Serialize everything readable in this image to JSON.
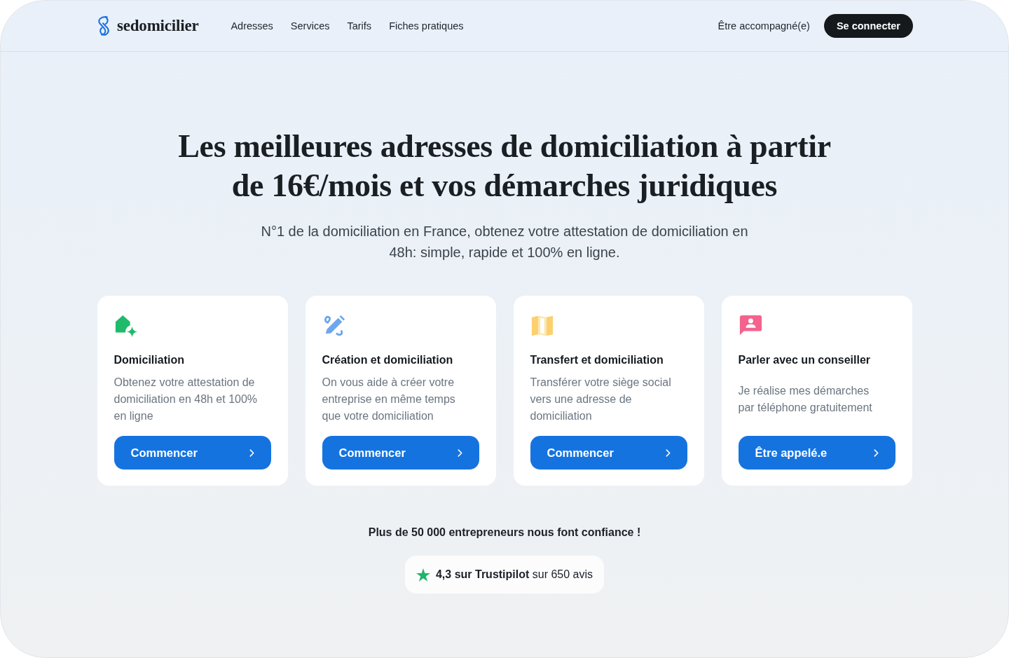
{
  "brand": {
    "name": "sedomicilier"
  },
  "nav": {
    "links": [
      "Adresses",
      "Services",
      "Tarifs",
      "Fiches pratiques"
    ],
    "secondary_link": "Être accompagné(e)",
    "login_button": "Se connecter"
  },
  "hero": {
    "title": "Les meilleures adresses de domiciliation à partir de **16€/mois** et vos démarches juridiques",
    "subtitle": "N°1 de la domiciliation en France, obtenez votre attestation de domiciliation en 48h: simple, rapide et 100% en ligne."
  },
  "cards": [
    {
      "kind": "domiciliation",
      "title": "Domiciliation",
      "description": "Obtenez votre attestation de domiciliation en 48h et 100% en ligne",
      "button": "Commencer"
    },
    {
      "kind": "creation",
      "title": "Création et domiciliation",
      "description": "On vous aide à créer votre entreprise en même temps que votre domiciliation",
      "button": "Commencer"
    },
    {
      "kind": "transfer",
      "title": "Transfert et domiciliation",
      "description": "Transférer votre siège social vers une adresse de domiciliation",
      "button": "Commencer"
    },
    {
      "kind": "advisor",
      "title": "Parler avec un conseiller",
      "description": "Je réalise mes démarches par téléphone gratuitement",
      "button": "Être appelé.e"
    }
  ],
  "trust": {
    "heading": "Plus de 50 000 entrepreneurs nous font confiance !",
    "rating": "**4,3 sur Trustipilot** sur 650 avis"
  }
}
